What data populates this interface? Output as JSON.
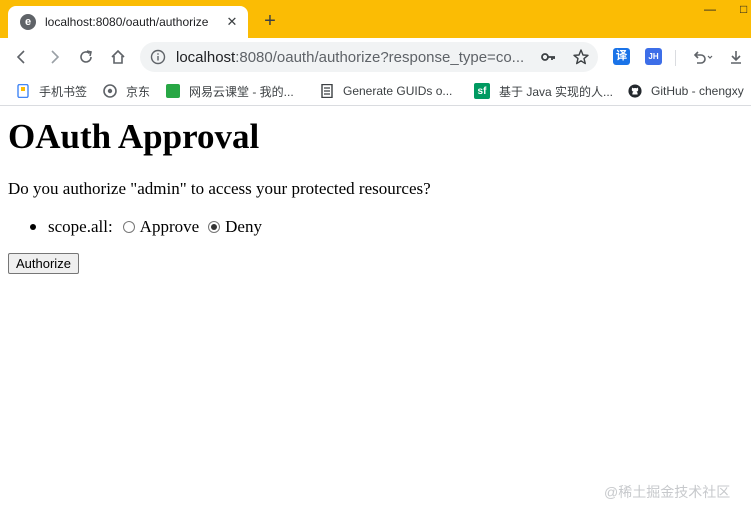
{
  "browser": {
    "tab": {
      "favicon": "e-icon",
      "title": "localhost:8080/oauth/authorize"
    },
    "window_controls": {
      "minimize": "—",
      "maximize": "□"
    },
    "address_bar": {
      "host": "localhost",
      "rest": ":8080/oauth/authorize?response_type=co..."
    },
    "extensions": [
      {
        "name": "translate-extension-icon",
        "label": "译"
      },
      {
        "name": "jh-extension-icon",
        "label": "JH"
      }
    ],
    "bookmarks": [
      {
        "label": "手机书签",
        "icon": "phone-bookmark-icon",
        "color": "#4285f4"
      },
      {
        "label": "京东",
        "icon": "jd-icon",
        "color": "#5f6368"
      },
      {
        "label": "网易云课堂 - 我的...",
        "icon": "netease-icon",
        "color": "#28a745"
      },
      {
        "label": "Generate GUIDs o...",
        "icon": "document-icon",
        "color": "#3c4043"
      },
      {
        "label": "基于 Java 实现的人...",
        "icon": "sf-icon",
        "color": "#009a61",
        "icon_text": "sf"
      },
      {
        "label": "GitHub - chengxy",
        "icon": "github-icon",
        "color": "#24292e"
      }
    ]
  },
  "page": {
    "title": "OAuth Approval",
    "prompt": "Do you authorize \"admin\" to access your protected resources?",
    "scopes": [
      {
        "label": "scope.all:",
        "options": [
          {
            "label": "Approve",
            "checked": false
          },
          {
            "label": "Deny",
            "checked": true
          }
        ]
      }
    ],
    "submit_label": "Authorize"
  },
  "watermark": "@稀土掘金技术社区",
  "colors": {
    "tabstrip": "#fbbc04",
    "omnibox": "#f1f3f4"
  }
}
